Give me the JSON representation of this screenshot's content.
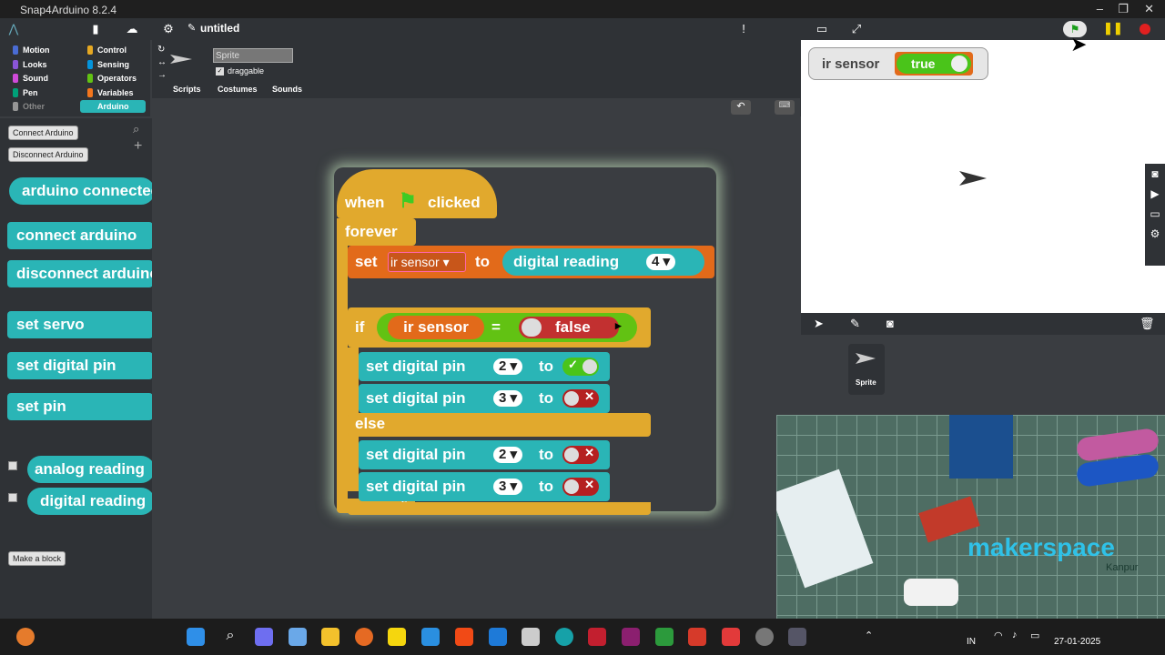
{
  "window": {
    "title": "Snap4Arduino 8.2.4",
    "min": "–",
    "max": "❐",
    "close": "✕"
  },
  "toolbar": {
    "project_name": "untitled"
  },
  "categories": [
    {
      "label": "Motion",
      "color": "#4a6cd4"
    },
    {
      "label": "Control",
      "color": "#e6a822"
    },
    {
      "label": "Looks",
      "color": "#8a55d7"
    },
    {
      "label": "Sensing",
      "color": "#0494dc"
    },
    {
      "label": "Sound",
      "color": "#cf4ad9"
    },
    {
      "label": "Operators",
      "color": "#62c213"
    },
    {
      "label": "Pen",
      "color": "#00a178"
    },
    {
      "label": "Variables",
      "color": "#f3761d"
    },
    {
      "label": "Other",
      "color": "#969696"
    },
    {
      "label": "Arduino",
      "color": "#2ab5b6"
    }
  ],
  "sprite": {
    "name": "Sprite",
    "draggable_label": "draggable"
  },
  "tabs": {
    "scripts": "Scripts",
    "costumes": "Costumes",
    "sounds": "Sounds"
  },
  "palette": {
    "connect_btn": "Connect Arduino",
    "disconnect_btn": "Disconnect Arduino",
    "blocks": [
      "arduino connected",
      "connect arduino",
      "disconnect arduino",
      "set servo",
      "set digital pin",
      "set pin",
      "analog reading",
      "digital reading"
    ],
    "make_block": "Make a block"
  },
  "script": {
    "hat": {
      "when": "when",
      "clicked": "clicked"
    },
    "forever": "forever",
    "set": {
      "set": "set",
      "var": "ir sensor",
      "to": "to",
      "reporter": "digital reading",
      "pin": "4"
    },
    "if": {
      "if": "if",
      "var": "ir sensor",
      "eq": "=",
      "value": "false"
    },
    "then": [
      {
        "label": "set digital pin",
        "pin": "2",
        "to": "to",
        "state": "true"
      },
      {
        "label": "set digital pin",
        "pin": "3",
        "to": "to",
        "state": "false"
      }
    ],
    "else": "else",
    "else_body": [
      {
        "label": "set digital pin",
        "pin": "2",
        "to": "to",
        "state": "false"
      },
      {
        "label": "set digital pin",
        "pin": "3",
        "to": "to",
        "state": "false"
      }
    ]
  },
  "stage": {
    "watcher_label": "ir sensor",
    "watcher_value": "true"
  },
  "corral": {
    "sprite_label": "Sprite"
  },
  "camera_overlay": {
    "brand": "makerspace",
    "city": "Kanpur"
  },
  "taskbar": {
    "lang": "IN",
    "date": "27-01-2025"
  }
}
